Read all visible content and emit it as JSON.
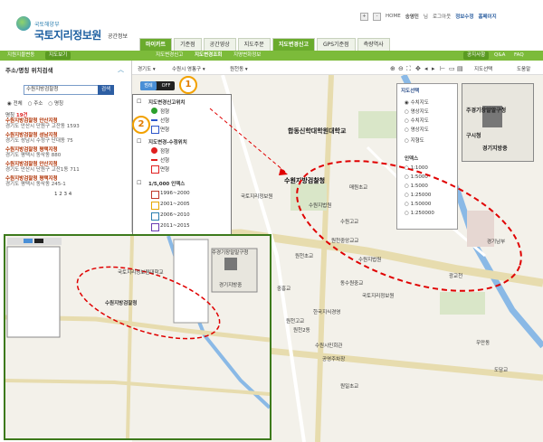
{
  "header": {
    "logo_small": "국토해양부",
    "logo_big": "국토지리정보원",
    "logo_sub": "공간정보",
    "util": [
      "+",
      "-",
      "HOME",
      "송영민",
      "님",
      "로그아웃",
      "정보수정",
      "홈페이지"
    ],
    "nav": [
      "마이카트",
      "기준점",
      "공간영상",
      "지도주문",
      "지도변경신고",
      "GPS기준점",
      "측량역사"
    ],
    "nav_active_index": 4,
    "subnav_left": [
      "지원지물변동",
      "지도보기"
    ],
    "subnav_center": [
      "지도변경신고",
      "지도변경조회",
      "지명변화정보"
    ],
    "subnav_right": [
      "공지사항",
      "Q&A",
      "FAQ"
    ]
  },
  "left_panel": {
    "title": "주소/명칭 위치검색",
    "search_value": "수원지방검찰청",
    "search_button": "검색",
    "radios": [
      "전체",
      "주소",
      "명칭"
    ],
    "count_label": "명칭",
    "count_value": "19건",
    "results": [
      {
        "title": "수원지방검찰청 안산지청",
        "addr": "경기도 안산시 단원구 고잔동 1593"
      },
      {
        "title": "수원지방검찰청 성남지청",
        "addr": "경기도 성남시 수정구 단대동 75"
      },
      {
        "title": "수원지방검찰청 평택지청",
        "addr": "경기도 평택시 동삭동 880"
      },
      {
        "title": "수원지방검찰청 안산지청",
        "addr": "경기도 안산시 단원구 고잔1동 711"
      },
      {
        "title": "수원지방검찰청 평택지청",
        "addr": "경기도 평택시 동삭동 245-1"
      }
    ],
    "pages": "1 2 3 4"
  },
  "map_toolbar": {
    "dropdowns": [
      "경기도",
      "수원시 영통구",
      "원천동"
    ],
    "right": [
      "지도선택",
      "도움말"
    ]
  },
  "legend": {
    "toggle_on": "범례",
    "toggle_off": "OFF",
    "groups": [
      {
        "title": "지도변경신고위치",
        "items": [
          "점형",
          "선형",
          "면형"
        ]
      },
      {
        "title": "지도변경-수정위치",
        "items": [
          "점형",
          "선형",
          "면형"
        ]
      },
      {
        "title": "1/5,000 인덱스",
        "items": [
          "1996~2000",
          "2001~2005",
          "2006~2010",
          "2011~2015"
        ]
      }
    ]
  },
  "map_type": {
    "title": "지도선택",
    "options": [
      "수치지도",
      "영상지도",
      "수치지도",
      "영상지도",
      "지형도"
    ],
    "scales_title": "인덱스",
    "scales": [
      "1:1000",
      "1:5000",
      "1:5000",
      "1:25000",
      "1:50000",
      "1:250000"
    ]
  },
  "overview": {
    "labels": [
      "주경기장말말구청",
      "경기지방중",
      "구시청"
    ]
  },
  "map_labels": {
    "target": "수원지방검찰청",
    "univ": "합동신학대학원대학교",
    "other": [
      "국토지리정보원",
      "수원지법원",
      "수원고교",
      "매원초교",
      "원천중앙교교",
      "경기남부",
      "원천초교",
      "수원지법원",
      "동수원중교",
      "국토지리정보원",
      "중흥교",
      "한국지식경영",
      "원천2동",
      "원천고교",
      "수원시민회관",
      "공영주차장",
      "우만동",
      "광교천",
      "원일초교",
      "도담교"
    ]
  },
  "inset_labels": [
    "수원지방검찰청",
    "국토지리정보원대학교",
    "주경기장말말구청",
    "경기지방중"
  ],
  "markers": [
    "1",
    "2"
  ],
  "colors": {
    "nav_active": "#6aab2d",
    "subbar": "#7cbb3a",
    "annot": "#e00000",
    "bubble": "#f2a100"
  }
}
